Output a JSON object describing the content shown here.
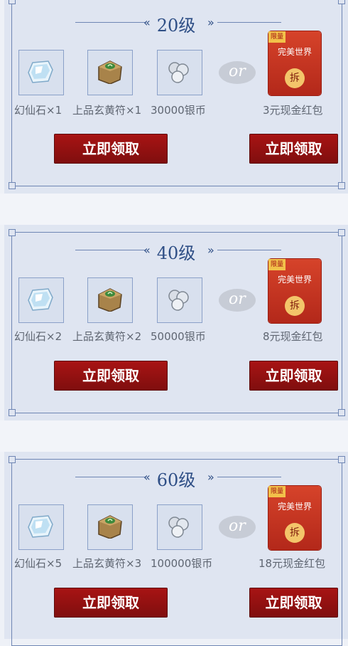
{
  "sections": [
    {
      "level_title": "20级",
      "items": [
        {
          "icon": "crystal-icon",
          "label": "幻仙石×1"
        },
        {
          "icon": "amulet-icon",
          "label": "上品玄黄符×1"
        },
        {
          "icon": "coins-icon",
          "label": "30000银币"
        }
      ],
      "or_text": "or",
      "redpack": {
        "tag": "限量",
        "brand": "完美世界",
        "seal": "拆",
        "label": "3元现金红包"
      },
      "claim_left": "立即领取",
      "claim_right": "立即领取"
    },
    {
      "level_title": "40级",
      "items": [
        {
          "icon": "crystal-icon",
          "label": "幻仙石×2"
        },
        {
          "icon": "amulet-icon",
          "label": "上品玄黄符×2"
        },
        {
          "icon": "coins-icon",
          "label": "50000银币"
        }
      ],
      "or_text": "or",
      "redpack": {
        "tag": "限量",
        "brand": "完美世界",
        "seal": "拆",
        "label": "8元现金红包"
      },
      "claim_left": "立即领取",
      "claim_right": "立即领取"
    },
    {
      "level_title": "60级",
      "items": [
        {
          "icon": "crystal-icon",
          "label": "幻仙石×5"
        },
        {
          "icon": "amulet-icon",
          "label": "上品玄黄符×3"
        },
        {
          "icon": "coins-icon",
          "label": "100000银币"
        }
      ],
      "or_text": "or",
      "redpack": {
        "tag": "限量",
        "brand": "完美世界",
        "seal": "拆",
        "label": "18元现金红包"
      },
      "claim_left": "立即领取",
      "claim_right": "立即领取"
    }
  ]
}
